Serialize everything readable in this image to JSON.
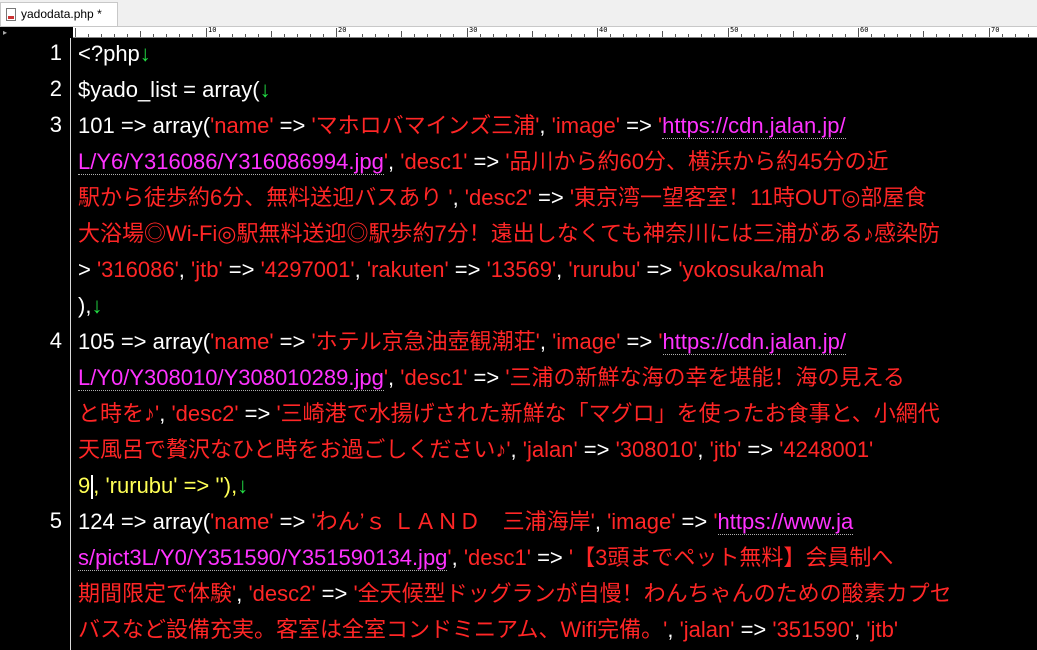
{
  "tab": {
    "label": "yadodata.php *"
  },
  "ruler": {
    "marks": [
      "10",
      "20",
      "30",
      "40",
      "50",
      "60",
      "70"
    ]
  },
  "gutter": {
    "line_numbers": [
      "1",
      "2",
      "3",
      "4",
      "5"
    ]
  },
  "code": {
    "l1": "<?php",
    "l2": "$yado_list = array(",
    "l3a_key": "101 => ",
    "l3a_arr": "array(",
    "l3a_name_k": "'name'",
    "arrow": " => ",
    "comma": ", ",
    "l3a_name_v": "'マホロバマインズ三浦'",
    "l3a_gap": ",  ",
    "l3a_image_k": "'image'",
    "l3a_q": "'",
    "l3a_url1": "https://cdn.jalan.jp/",
    "l3b_url2": "L/Y6/Y316086/Y316086994.jpg",
    "l3b_desc1_k": "'desc1'",
    "l3b_desc1_v": "'品川から約60分、横浜から約45分の近",
    "l3c_text": "駅から徒歩約6分、無料送迎バスあり '",
    "l3c_desc2_k": "'desc2'",
    "l3c_desc2_v": "'東京湾一望客室！11時OUT◎部屋食",
    "l3d_text": "大浴場◎Wi-Fi◎駅無料送迎◎駅歩約7分！遠出しなくても神奈川には三浦がある♪感染防",
    "l3e_pre": "> ",
    "l3e_v1": "'316086'",
    "l3e_jtb_k": "'jtb'",
    "l3e_jtb_v": "'4297001'",
    "l3e_rak_k": "'rakuten'",
    "l3e_rak_v": "'13569'",
    "l3e_rur_k": "'rurubu'",
    "l3e_rur_v": "'yokosuka/mah",
    "l3f": "),",
    "l4a_key": "105 => ",
    "l4a_name_v": "'ホテル京急油壺観潮荘'",
    "l4a_url1": "https://cdn.jalan.jp/",
    "l4b_url2": "L/Y0/Y308010/Y308010289.jpg",
    "l4b_desc1_v": "'三浦の新鮮な海の幸を堪能！海の見える",
    "l4c_text": "と時を♪'",
    "l4c_desc2_v": "'三崎港で水揚げされた新鮮な「マグロ」を使ったお食事と、小網代",
    "l4d_text": "天風呂で贅沢なひと時をお過ごしください♪'",
    "l4d_jalan_k": "'jalan'",
    "l4d_jalan_v": "'308010'",
    "l4d_jtb_v": "'4248001'",
    "l4e_num": "9",
    "l4e_rest": ", 'rurubu' => ''),",
    "l5a_key": "124 => ",
    "l5a_name_v": "'わん’ｓ ＬＡＮＤ　三浦海岸'",
    "l5a_url1": "https://www.ja",
    "l5b_url2": "s/pict3L/Y0/Y351590/Y351590134.jpg",
    "l5b_desc1_v": "'【3頭までペット無料】会員制へ",
    "l5c_text": "期間限定で体験'",
    "l5c_desc2_v": "'全天候型ドッグランが自慢！わんちゃんのための酸素カプセ",
    "l5d_text": "バスなど設備充実。客室は全室コンドミニアム、Wifi完備。'",
    "l5d_jalan_v": "'351590'",
    "l5d_jtb_k": "'jtb'",
    "eol": "↓"
  }
}
